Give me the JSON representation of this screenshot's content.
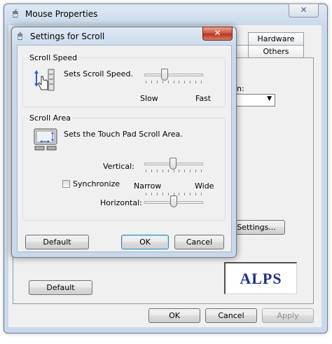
{
  "main_window": {
    "title": "Mouse Properties",
    "tabs_row1": [
      "Hardware"
    ],
    "tabs_row2": [
      "Others"
    ],
    "label_partial": "n:",
    "settings_button": "Settings...",
    "logo_text": "ALPS",
    "default_button": "Default",
    "ok_button": "OK",
    "cancel_button": "Cancel",
    "apply_button": "Apply",
    "close_glyph": "✕"
  },
  "dialog": {
    "title": "Settings for Scroll",
    "close_glyph": "✕",
    "scroll_speed": {
      "group_label": "Scroll Speed",
      "description": "Sets Scroll Speed.",
      "slider_min_label": "Slow",
      "slider_max_label": "Fast",
      "slider_value": 0.33
    },
    "scroll_area": {
      "group_label": "Scroll Area",
      "description": "Sets the Touch Pad Scroll Area.",
      "vertical_label": "Vertical:",
      "vertical_value": 0.48,
      "synchronize_label": "Synchronize",
      "synchronize_checked": false,
      "narrow_label": "Narrow",
      "wide_label": "Wide",
      "horizontal_label": "Horizontal:",
      "horizontal_value": 0.5
    },
    "default_button": "Default",
    "ok_button": "OK",
    "cancel_button": "Cancel"
  },
  "colors": {
    "logo_text": "#1e2e8a",
    "accent_blue": "#2a5fd0"
  }
}
